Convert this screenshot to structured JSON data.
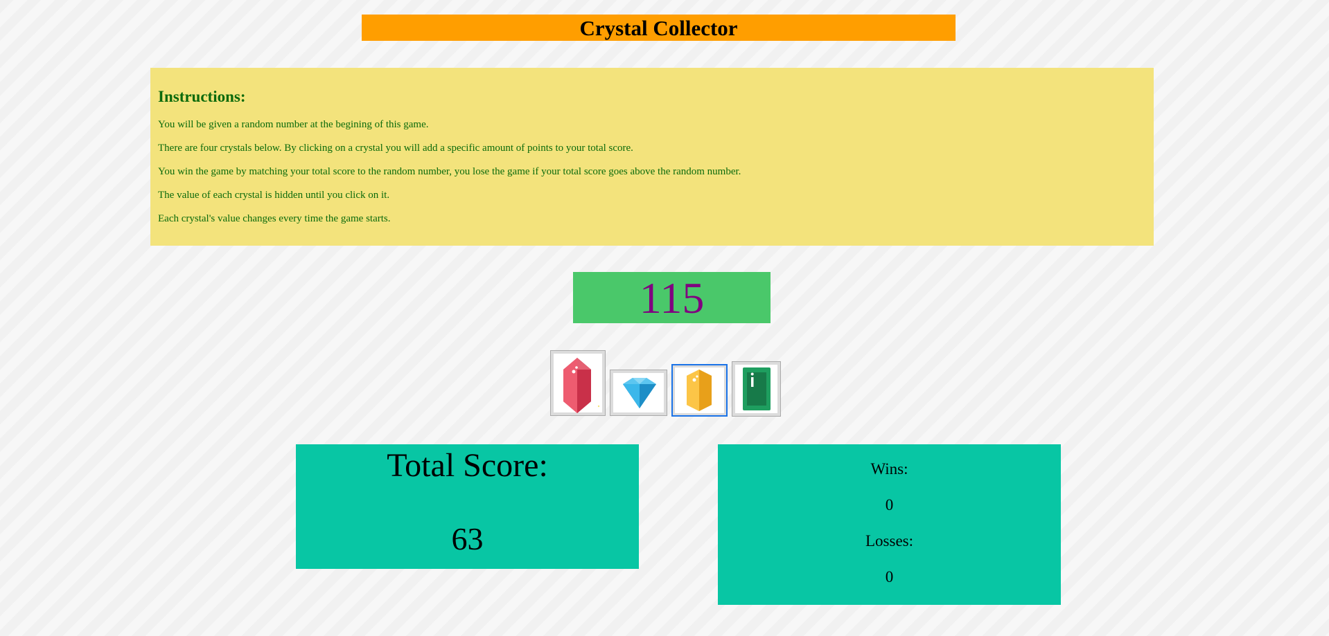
{
  "header": {
    "title": "Crystal Collector"
  },
  "instructions": {
    "heading": "Instructions:",
    "lines": [
      "You will be given a random number at the begining of this game.",
      "There are four crystals below. By clicking on a crystal you will add a specific amount of points to your total score.",
      "You win the game by matching your total score to the random number, you lose the game if your total score goes above the random number.",
      "The value of each crystal is hidden until you click on it.",
      "Each crystal's value changes every time the game starts."
    ]
  },
  "target": {
    "number": "115"
  },
  "crystals": [
    {
      "icon": "red-crystal-icon",
      "color": "#e24a5e"
    },
    {
      "icon": "blue-diamond-icon",
      "color": "#29abe2"
    },
    {
      "icon": "yellow-crystal-icon",
      "color": "#f8b62e"
    },
    {
      "icon": "green-emerald-icon",
      "color": "#1e9e5f"
    }
  ],
  "score": {
    "label": "Total Score:",
    "value": "63"
  },
  "stats": {
    "wins_label": "Wins:",
    "wins": "0",
    "losses_label": "Losses:",
    "losses": "0"
  },
  "colors": {
    "title_bar": "#ff9e00",
    "instructions_bg": "#f3e37c",
    "instructions_text": "#0b6a0b",
    "target_bg": "#4ac86a",
    "target_text": "#800080",
    "score_bg": "#08c6a4"
  }
}
